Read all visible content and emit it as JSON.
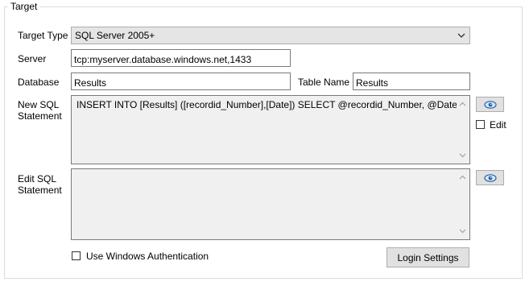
{
  "group": {
    "title": "Target"
  },
  "target_type": {
    "label": "Target Type",
    "value": "SQL Server 2005+"
  },
  "server": {
    "label": "Server",
    "value": "tcp:myserver.database.windows.net,1433"
  },
  "database": {
    "label": "Database",
    "value": "Results"
  },
  "table_name": {
    "label": "Table Name",
    "value": "Results"
  },
  "new_sql": {
    "label_line1": "New SQL",
    "label_line2": "Statement",
    "value": "INSERT INTO [Results] ([recordid_Number],[Date]) SELECT @recordid_Number, @Date;"
  },
  "edit_checkbox": {
    "label": "Edit",
    "checked": false
  },
  "edit_sql": {
    "label_line1": "Edit SQL",
    "label_line2": "Statement",
    "value": ""
  },
  "windows_auth": {
    "label": "Use Windows Authentication",
    "checked": false
  },
  "login_settings": {
    "label": "Login Settings"
  },
  "icons": {
    "view": "eye-icon",
    "dropdown": "chevron-down-icon"
  },
  "colors": {
    "button_face": "#e1e1e1",
    "readonly_bg": "#f0f0f0",
    "icon_blue": "#1f5fa8"
  }
}
